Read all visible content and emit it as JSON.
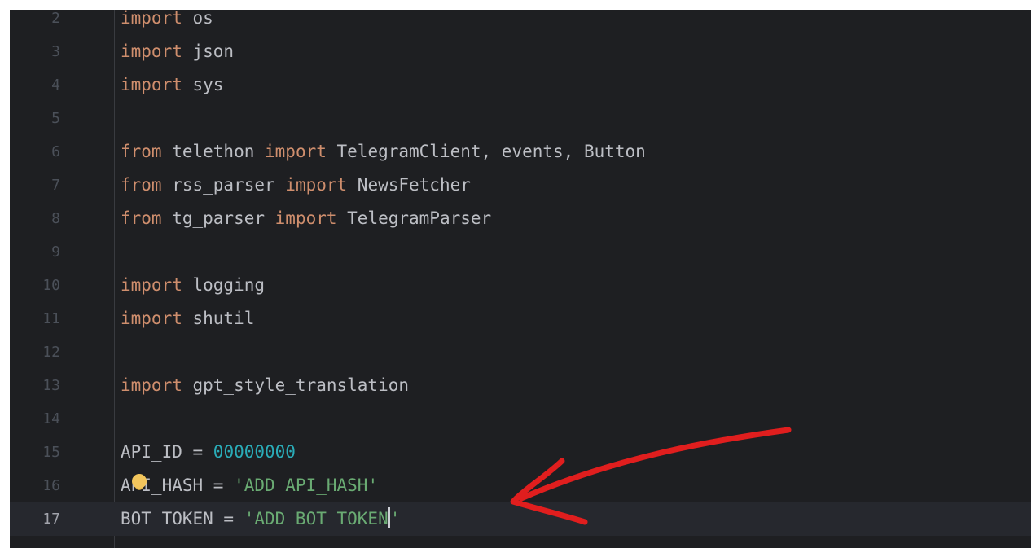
{
  "editor": {
    "lines": [
      {
        "number": "2",
        "tokens": [
          {
            "t": "kw",
            "v": "import"
          },
          {
            "t": "plain",
            "v": " os"
          }
        ]
      },
      {
        "number": "3",
        "tokens": [
          {
            "t": "kw",
            "v": "import"
          },
          {
            "t": "plain",
            "v": " json"
          }
        ]
      },
      {
        "number": "4",
        "tokens": [
          {
            "t": "kw",
            "v": "import"
          },
          {
            "t": "plain",
            "v": " sys"
          }
        ]
      },
      {
        "number": "5",
        "tokens": []
      },
      {
        "number": "6",
        "tokens": [
          {
            "t": "kw",
            "v": "from"
          },
          {
            "t": "plain",
            "v": " telethon "
          },
          {
            "t": "kw",
            "v": "import"
          },
          {
            "t": "plain",
            "v": " TelegramClient, events, Button"
          }
        ]
      },
      {
        "number": "7",
        "tokens": [
          {
            "t": "kw",
            "v": "from"
          },
          {
            "t": "plain",
            "v": " rss_parser "
          },
          {
            "t": "kw",
            "v": "import"
          },
          {
            "t": "plain",
            "v": " NewsFetcher"
          }
        ]
      },
      {
        "number": "8",
        "tokens": [
          {
            "t": "kw",
            "v": "from"
          },
          {
            "t": "plain",
            "v": " tg_parser "
          },
          {
            "t": "kw",
            "v": "import"
          },
          {
            "t": "plain",
            "v": " TelegramParser"
          }
        ]
      },
      {
        "number": "9",
        "tokens": []
      },
      {
        "number": "10",
        "tokens": [
          {
            "t": "kw",
            "v": "import"
          },
          {
            "t": "plain",
            "v": " logging"
          }
        ]
      },
      {
        "number": "11",
        "tokens": [
          {
            "t": "kw",
            "v": "import"
          },
          {
            "t": "plain",
            "v": " shutil"
          }
        ]
      },
      {
        "number": "12",
        "tokens": []
      },
      {
        "number": "13",
        "tokens": [
          {
            "t": "kw",
            "v": "import"
          },
          {
            "t": "plain",
            "v": " gpt_style_translation"
          }
        ]
      },
      {
        "number": "14",
        "tokens": []
      },
      {
        "number": "15",
        "tokens": [
          {
            "t": "plain",
            "v": "API_ID = "
          },
          {
            "t": "num",
            "v": "00000000"
          }
        ]
      },
      {
        "number": "16",
        "tokens": [
          {
            "t": "plain",
            "v": "API_HASH = "
          },
          {
            "t": "str",
            "v": "'ADD API_HASH'"
          }
        ]
      },
      {
        "number": "17",
        "current": true,
        "tokens": [
          {
            "t": "plain",
            "v": "BOT_TOKEN = "
          },
          {
            "t": "str",
            "v": "'ADD BOT TOKEN"
          },
          {
            "t": "caret",
            "v": ""
          },
          {
            "t": "str",
            "v": "'"
          }
        ]
      }
    ]
  },
  "colors": {
    "background": "#1e1f22",
    "keyword": "#cf8e6d",
    "number": "#2aacb8",
    "string": "#6aab73",
    "text": "#bcbec4",
    "annotation": "#e01e1e"
  },
  "icons": {
    "intention_bulb": "lightbulb-icon"
  }
}
